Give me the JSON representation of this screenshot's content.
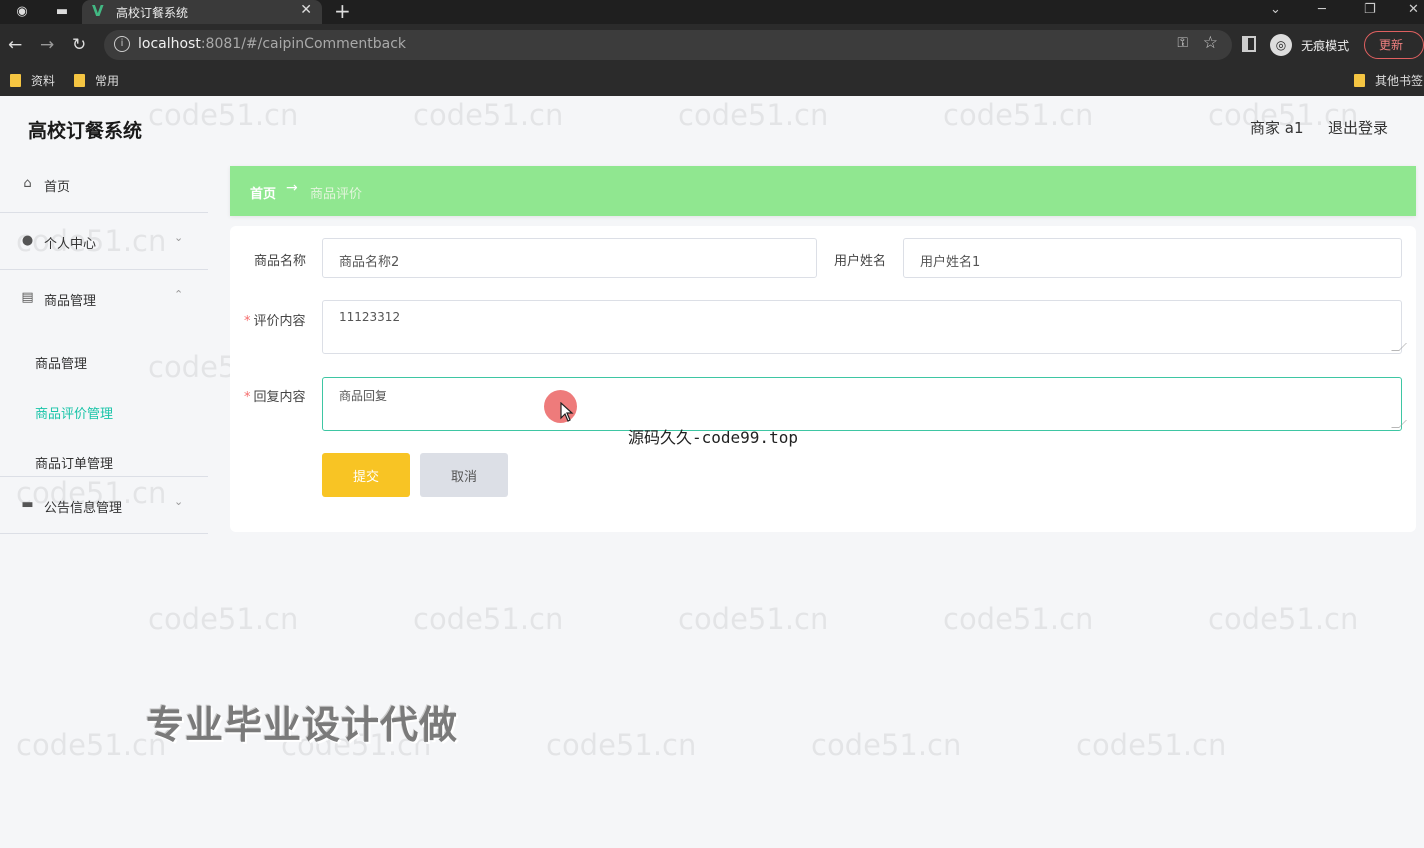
{
  "browser": {
    "tab_title": "高校订餐系统",
    "url_host": "localhost",
    "url_rest": ":8081/#/caipinCommentback",
    "incognito_label": "无痕模式",
    "update_label": "更新",
    "bookmarks": [
      "资料",
      "常用"
    ],
    "other_bookmarks": "其他书签"
  },
  "header": {
    "brand": "高校订餐系统",
    "user": "商家 a1",
    "logout": "退出登录"
  },
  "sidebar": {
    "home": "首页",
    "personal": "个人中心",
    "product_mgmt": "商品管理",
    "sub_items": [
      "商品管理",
      "商品评价管理",
      "商品订单管理"
    ],
    "notice_mgmt": "公告信息管理"
  },
  "breadcrumb": {
    "home": "首页",
    "arrow": "→",
    "current": "商品评价"
  },
  "form": {
    "product_name_label": "商品名称",
    "product_name_value": "商品名称2",
    "user_name_label": "用户姓名",
    "user_name_value": "用户姓名1",
    "comment_label": "评价内容",
    "comment_value": "11123312",
    "reply_label": "回复内容",
    "reply_value": "商品回复",
    "required_mark": "*",
    "submit": "提交",
    "cancel": "取消"
  },
  "overlay": {
    "code_text": "源码久久-code99.top",
    "ad_text": "专业毕业设计代做",
    "watermark": "code51.cn"
  },
  "colors": {
    "breadcrumb_bg": "#90e790",
    "active_menu": "#19c4a8",
    "submit_bg": "#f8c424",
    "cancel_bg": "#dcdfe6"
  }
}
